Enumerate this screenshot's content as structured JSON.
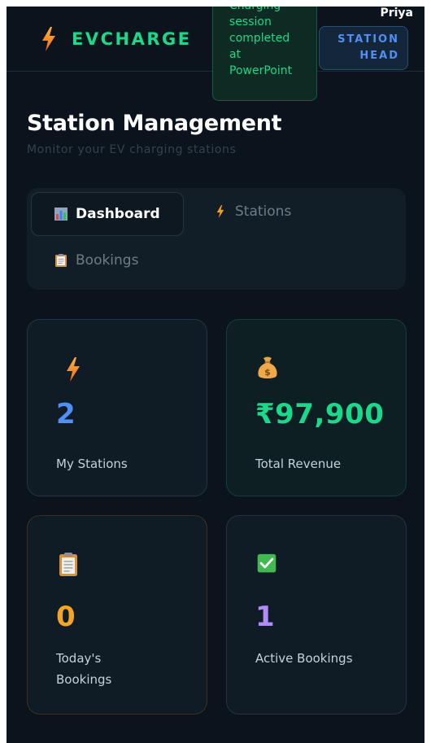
{
  "app": {
    "brand": "EVCHARGE",
    "user_name": "Priya",
    "role_line1": "STATION",
    "role_line2": "HEAD"
  },
  "toast": {
    "lines": [
      "Charging",
      "session",
      "completed",
      "at",
      "PowerPoint"
    ]
  },
  "page": {
    "title": "Station Management",
    "subtitle": "Monitor your EV charging stations"
  },
  "tabs": [
    {
      "label": "Dashboard",
      "icon": "bar-chart-icon",
      "active": true
    },
    {
      "label": "Stations",
      "icon": "bolt-icon",
      "active": false
    },
    {
      "label": "Bookings",
      "icon": "clipboard-icon",
      "active": false
    }
  ],
  "stats": [
    {
      "icon": "bolt-icon",
      "value": "2",
      "label": "My Stations",
      "color": "#4f8ff7"
    },
    {
      "icon": "money-bag-icon",
      "value": "₹97,900",
      "label": "Total Revenue",
      "color": "#19d98a"
    },
    {
      "icon": "clipboard-icon",
      "value": "0",
      "label_line1": "Today's",
      "label_line2": "Bookings",
      "color": "#f5a524"
    },
    {
      "icon": "check-box-icon",
      "value": "1",
      "label": "Active Bookings",
      "color": "#b18cf7"
    }
  ],
  "colors": {
    "background": "#0b141c",
    "accent_green": "#19d98a",
    "accent_blue": "#4f8ff7",
    "accent_orange": "#f5a524",
    "accent_purple": "#b18cf7"
  }
}
